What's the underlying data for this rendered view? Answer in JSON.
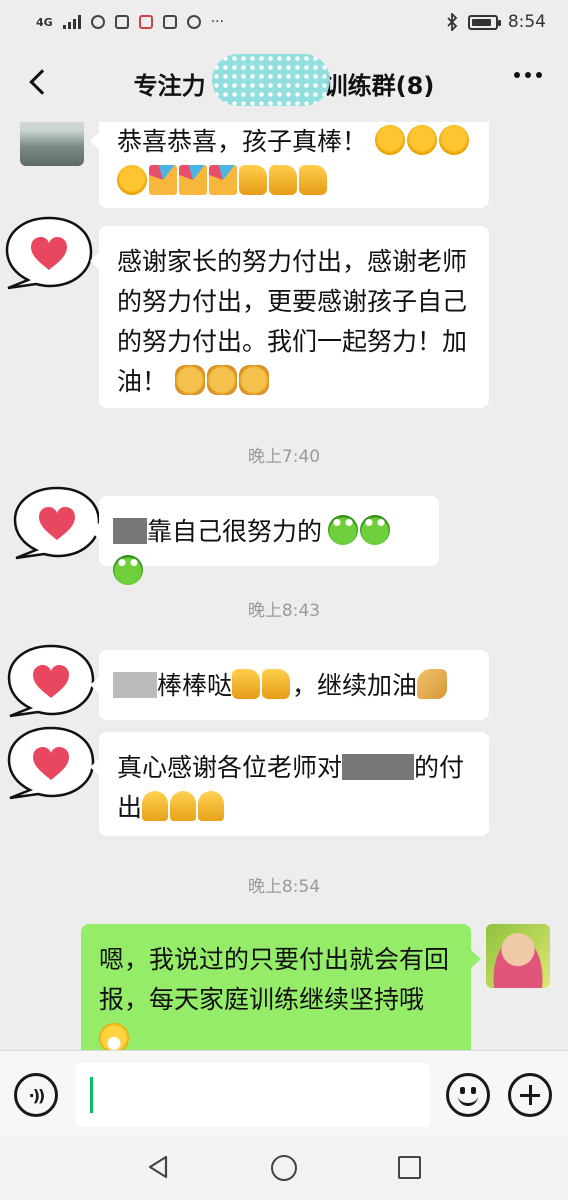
{
  "status_bar": {
    "network": "4G",
    "time": "8:54",
    "battery_level": 0.85
  },
  "header": {
    "title_prefix": "专注力",
    "title_suffix": "训练群(8)"
  },
  "messages": [
    {
      "sender": "other",
      "avatar": "landscape-photo-avatar",
      "text": "恭喜恭喜，孩子真棒！",
      "emojis": [
        "hug",
        "hug",
        "hug",
        "hug",
        "party",
        "party",
        "party",
        "thumb",
        "thumb",
        "thumb"
      ]
    },
    {
      "sender": "other",
      "avatar": "heart-icon-avatar",
      "text": "感谢家长的努力付出，感谢老师的努力付出，更要感谢孩子自己的努力付出。我们一起努力！加油！",
      "emojis": [
        "fist",
        "fist",
        "fist"
      ]
    },
    {
      "time": "晚上7:40"
    },
    {
      "sender": "other",
      "avatar": "heart-icon-avatar",
      "text": "靠自己很努力的",
      "emojis": [
        "frog",
        "frog",
        "frog"
      ]
    },
    {
      "time": "晚上8:43"
    },
    {
      "sender": "other",
      "avatar": "heart-icon-avatar",
      "text_a": "棒棒哒",
      "text_b": "，继续加油",
      "emojis": [
        "thumb",
        "thumb",
        "flex"
      ]
    },
    {
      "sender": "other",
      "avatar": "heart-icon-avatar",
      "text_a": "真心感谢各位老师对",
      "text_b": "的付出",
      "emojis": [
        "pray",
        "pray",
        "pray"
      ]
    },
    {
      "time": "晚上8:54"
    },
    {
      "sender": "self",
      "avatar": "woman-photo-avatar",
      "text": "嗯，我说过的只要付出就会有回报，每天家庭训练继续坚持哦",
      "emojis": [
        "grin"
      ]
    }
  ],
  "input_bar": {
    "value": "",
    "placeholder": ""
  },
  "colors": {
    "accent_green": "#95ec69",
    "heart_red": "#e8475f",
    "background": "#ededed"
  },
  "icons": [
    "back-icon",
    "more-icon",
    "voice-icon",
    "emoji-icon",
    "plus-icon",
    "nav-back-icon",
    "nav-home-icon",
    "nav-recent-icon"
  ]
}
